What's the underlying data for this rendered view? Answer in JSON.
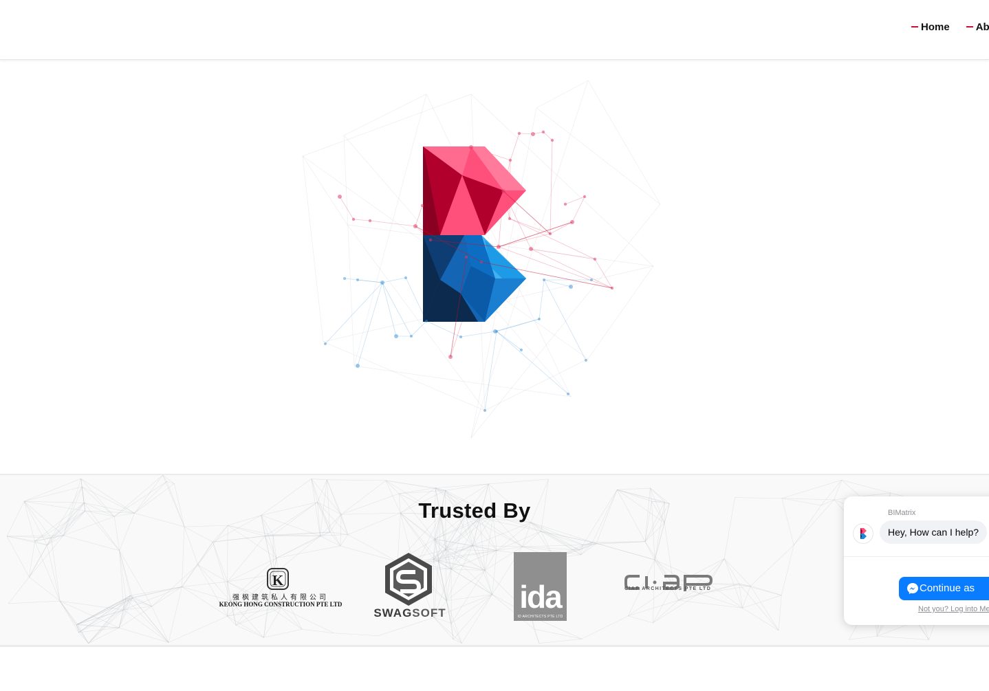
{
  "nav": {
    "items": [
      {
        "label": "Home"
      },
      {
        "label": "About"
      }
    ]
  },
  "trusted": {
    "title": "Trusted By",
    "logos": [
      {
        "name": "keong-hong",
        "chinese": "强枫建筑私人有限公司",
        "text": "KEONG HONG CONSTRUCTION PTE LTD"
      },
      {
        "name": "swagsoft",
        "text_a": "SWAG",
        "text_b": "SOFT"
      },
      {
        "name": "ida",
        "text": "ida",
        "subtext": "ID ARCHITECTS PTE LTD"
      },
      {
        "name": "ciap",
        "text": "CIAP ARCHITECTS PTE LTD"
      }
    ]
  },
  "chat": {
    "sender": "BIMatrix",
    "message": "Hey, How can I help?",
    "continue_label": "Continue as",
    "not_you_label": "Not you? Log into Messenger"
  },
  "colors": {
    "accent_red": "#c8102e",
    "logo_pink": "#ff4f7b",
    "logo_crimson": "#b0002b",
    "logo_blue": "#1e88d6",
    "logo_navy": "#0d2b4e",
    "messenger_blue": "#0a7cff"
  }
}
